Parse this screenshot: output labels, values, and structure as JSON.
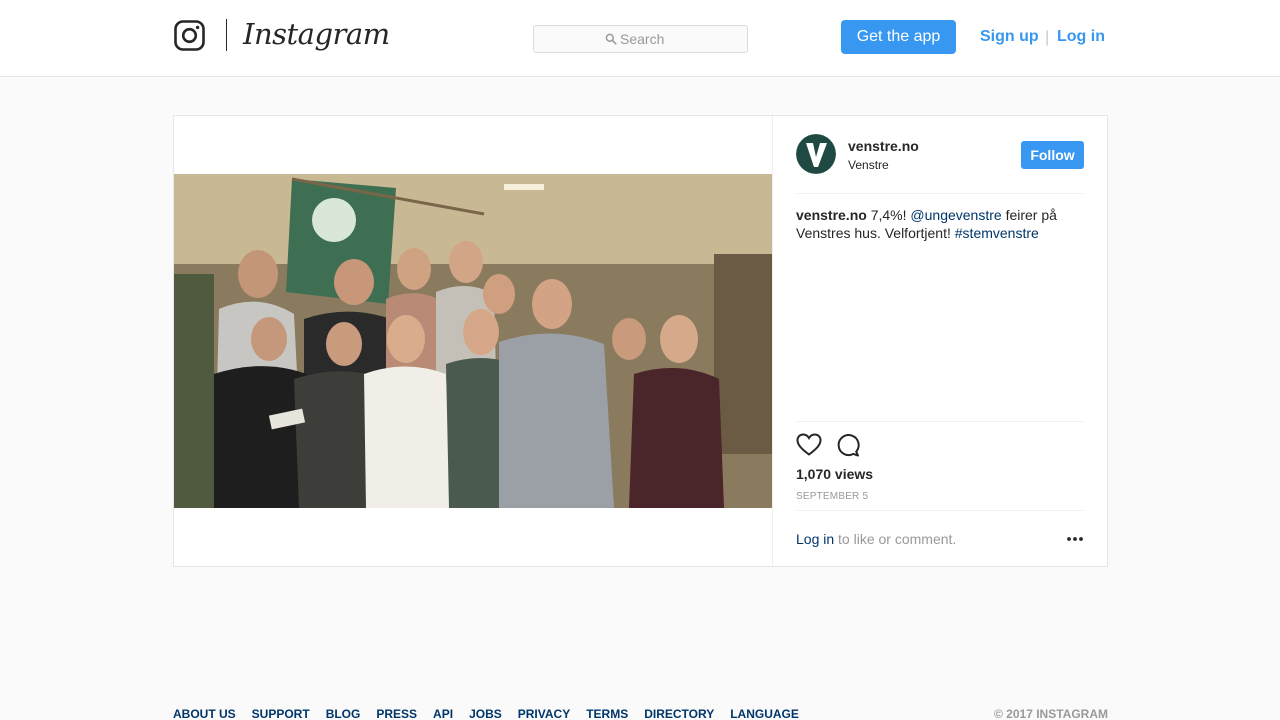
{
  "header": {
    "wordmark": "Instagram",
    "search_placeholder": "Search",
    "get_app_label": "Get the app",
    "signup_label": "Sign up",
    "separator": "|",
    "login_label": "Log in"
  },
  "post": {
    "author": {
      "handle": "venstre.no",
      "full_name": "Venstre"
    },
    "follow_label": "Follow",
    "caption": {
      "author": "venstre.no",
      "text_before": " 7,4%! ",
      "mention": "@ungevenstre",
      "text_after": " feirer på Venstres hus. Velfortjent! ",
      "hashtag": "#stemvenstre"
    },
    "views": "1,070 views",
    "date": "SEPTEMBER 5",
    "login_link": "Log in",
    "login_suffix": " to like or comment."
  },
  "icons": {
    "brand": "instagram-glyph-icon",
    "search": "search-icon",
    "like": "heart-icon",
    "comment": "comment-icon",
    "more": "more-options-icon"
  },
  "colors": {
    "accent": "#3897f0",
    "link": "#003569",
    "muted": "#999999"
  },
  "footer": {
    "links": [
      "ABOUT US",
      "SUPPORT",
      "BLOG",
      "PRESS",
      "API",
      "JOBS",
      "PRIVACY",
      "TERMS",
      "DIRECTORY",
      "LANGUAGE"
    ],
    "copyright": "© 2017 INSTAGRAM"
  }
}
